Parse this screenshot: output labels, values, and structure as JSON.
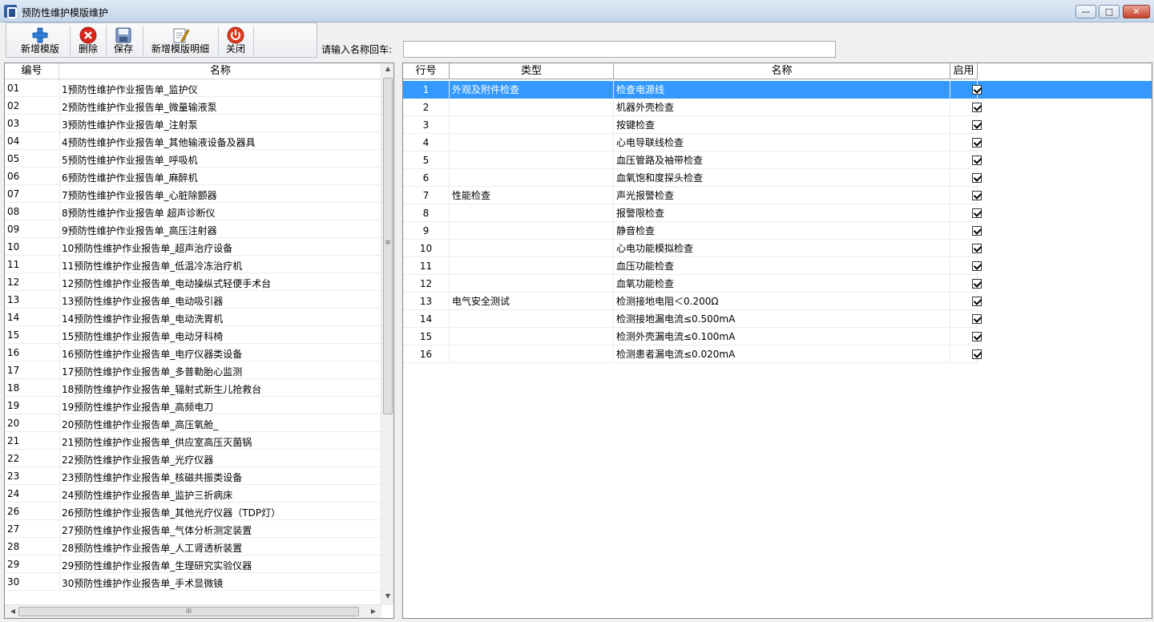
{
  "window": {
    "title": "预防性维护模版维护",
    "min": "—",
    "max": "□",
    "close": "✕"
  },
  "toolbar": {
    "buttons": [
      {
        "label": "新增模版",
        "icon": "add-icon"
      },
      {
        "label": "删除",
        "icon": "delete-icon"
      },
      {
        "label": "保存",
        "icon": "save-icon"
      },
      {
        "label": "新增模版明细",
        "icon": "edit-detail-icon"
      },
      {
        "label": "关闭",
        "icon": "power-icon"
      }
    ]
  },
  "search": {
    "label": "请输入名称回车:",
    "value": ""
  },
  "left_table": {
    "headers": [
      "编号",
      "名称"
    ],
    "rows": [
      [
        "01",
        "1预防性维护作业报告单_监护仪"
      ],
      [
        "02",
        "2预防性维护作业报告单_微量输液泵"
      ],
      [
        "03",
        "3预防性维护作业报告单_注射泵"
      ],
      [
        "04",
        "4预防性维护作业报告单_其他输液设备及器具"
      ],
      [
        "05",
        "5预防性维护作业报告单_呼吸机"
      ],
      [
        "06",
        "6预防性维护作业报告单_麻醉机"
      ],
      [
        "07",
        "7预防性维护作业报告单_心脏除颤器"
      ],
      [
        "08",
        "8预防性维护作业报告单 超声诊断仪"
      ],
      [
        "09",
        "9预防性维护作业报告单_高压注射器"
      ],
      [
        "10",
        "10预防性维护作业报告单_超声治疗设备"
      ],
      [
        "11",
        "11预防性维护作业报告单_低温冷冻治疗机"
      ],
      [
        "12",
        "12预防性维护作业报告单_电动操纵式轻便手术台"
      ],
      [
        "13",
        "13预防性维护作业报告单_电动吸引器"
      ],
      [
        "14",
        "14预防性维护作业报告单_电动洗胃机"
      ],
      [
        "15",
        "15预防性维护作业报告单_电动牙科椅"
      ],
      [
        "16",
        "16预防性维护作业报告单_电疗仪器类设备"
      ],
      [
        "17",
        "17预防性维护作业报告单_多普勒胎心监测"
      ],
      [
        "18",
        "18预防性维护作业报告单_辐射式新生儿抢救台"
      ],
      [
        "19",
        "19预防性维护作业报告单_高频电刀"
      ],
      [
        "20",
        "20预防性维护作业报告单_高压氧舱_"
      ],
      [
        "21",
        "21预防性维护作业报告单_供应室高压灭菌锅"
      ],
      [
        "22",
        "22预防性维护作业报告单_光疗仪器"
      ],
      [
        "23",
        "23预防性维护作业报告单_核磁共振类设备"
      ],
      [
        "24",
        "24预防性维护作业报告单_监护三折病床"
      ],
      [
        "26",
        "26预防性维护作业报告单_其他光疗仪器（TDP灯）"
      ],
      [
        "27",
        "27预防性维护作业报告单_气体分析测定装置"
      ],
      [
        "28",
        "28预防性维护作业报告单_人工肾透析装置"
      ],
      [
        "29",
        "29预防性维护作业报告单_生理研究实验仪器"
      ],
      [
        "30",
        "30预防性维护作业报告单_手术显微镜"
      ]
    ],
    "scroll_mid_glyph": "≡",
    "hscroll_mid_glyph": "III"
  },
  "right_table": {
    "headers": [
      "行号",
      "类型",
      "名称",
      "启用"
    ],
    "rows": [
      [
        "1",
        "外观及附件检查",
        "检查电源线",
        true
      ],
      [
        "2",
        "",
        "机器外壳检查",
        true
      ],
      [
        "3",
        "",
        "按键检查",
        true
      ],
      [
        "4",
        "",
        "心电导联线检查",
        true
      ],
      [
        "5",
        "",
        "血压管路及袖带检查",
        true
      ],
      [
        "6",
        "",
        "血氧饱和度探头检查",
        true
      ],
      [
        "7",
        "性能检查",
        "声光报警检查",
        true
      ],
      [
        "8",
        "",
        "报警限检查",
        true
      ],
      [
        "9",
        "",
        "静音检查",
        true
      ],
      [
        "10",
        "",
        "心电功能模拟检查",
        true
      ],
      [
        "11",
        "",
        "血压功能检查",
        true
      ],
      [
        "12",
        "",
        "血氧功能检查",
        true
      ],
      [
        "13",
        "电气安全测试",
        "检测接地电阻＜0.200Ω",
        true
      ],
      [
        "14",
        "",
        "检测接地漏电流≤0.500mA",
        true
      ],
      [
        "15",
        "",
        "检测外壳漏电流≤0.100mA",
        true
      ],
      [
        "16",
        "",
        "检测患者漏电流≤0.020mA",
        true
      ]
    ],
    "selected_row": 0
  },
  "colors": {
    "selection": "#3399ff",
    "title_bar": "#c4d5ea"
  }
}
